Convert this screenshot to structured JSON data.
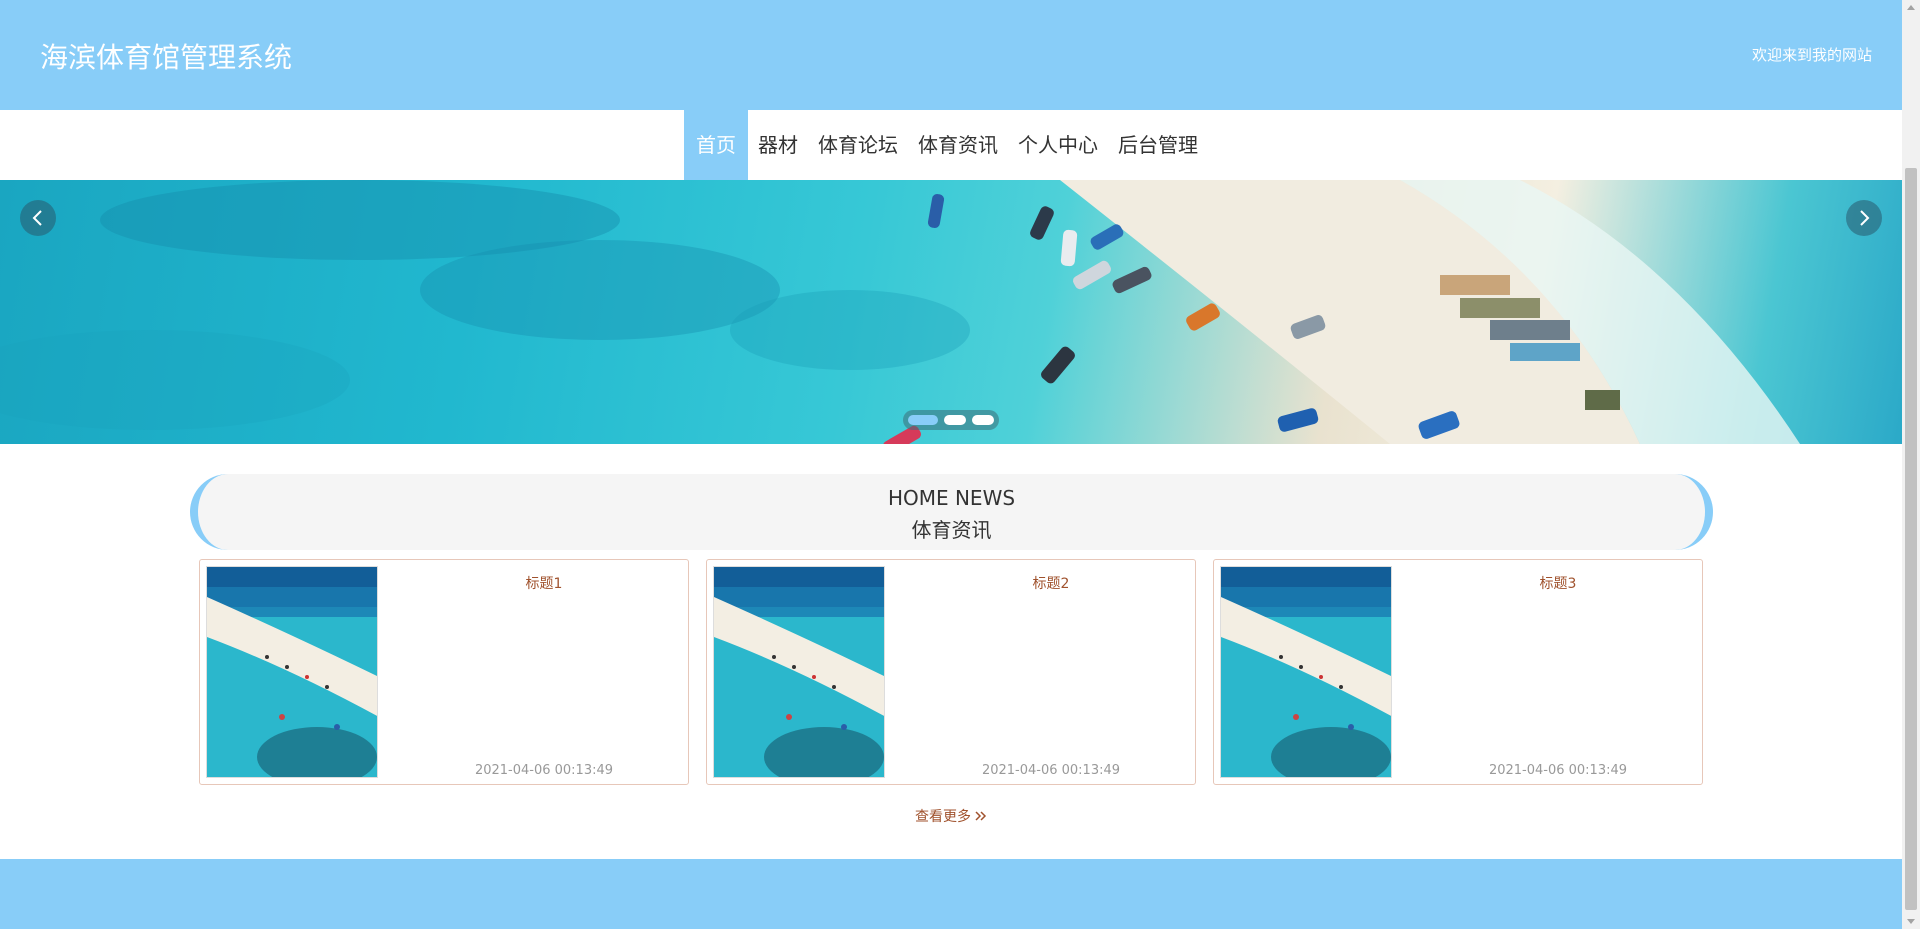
{
  "header": {
    "title": "海滨体育馆管理系统",
    "welcome": "欢迎来到我的网站"
  },
  "nav": {
    "items": [
      {
        "label": "首页",
        "active": true
      },
      {
        "label": "器材",
        "active": false
      },
      {
        "label": "体育论坛",
        "active": false
      },
      {
        "label": "体育资讯",
        "active": false
      },
      {
        "label": "个人中心",
        "active": false
      },
      {
        "label": "后台管理",
        "active": false
      }
    ]
  },
  "carousel": {
    "prev_icon": "chevron-left-icon",
    "next_icon": "chevron-right-icon",
    "slide_count": 3,
    "active_slide": 1
  },
  "news": {
    "title_en": "HOME NEWS",
    "title_cn": "体育资讯",
    "items": [
      {
        "title": "标题1",
        "time": "2021-04-06 00:13:49"
      },
      {
        "title": "标题2",
        "time": "2021-04-06 00:13:49"
      },
      {
        "title": "标题3",
        "time": "2021-04-06 00:13:49"
      }
    ],
    "more_label": "查看更多",
    "more_icon": "double-chevron-right-icon"
  },
  "colors": {
    "primary": "#88cdf8",
    "card_border": "#e7c7b9",
    "card_title": "#a0522d",
    "timestamp": "#999999"
  }
}
